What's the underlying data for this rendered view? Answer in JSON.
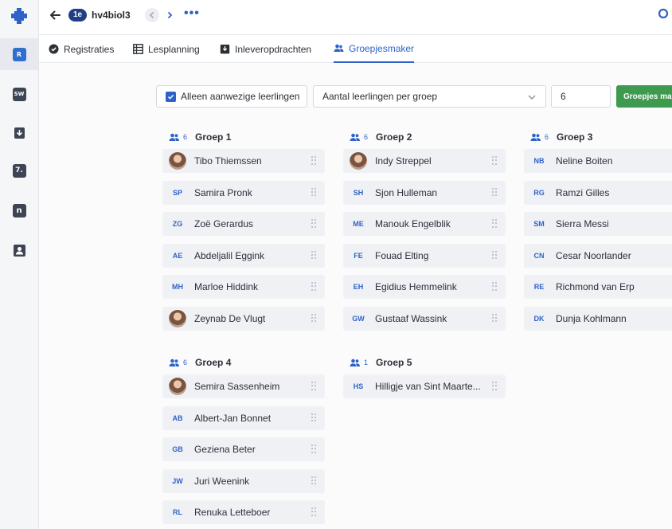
{
  "sidebar": {
    "items": [
      {
        "icon": "registration-icon",
        "label": "R",
        "active": true
      },
      {
        "icon": "sw-icon",
        "label": "SW",
        "active": false
      },
      {
        "icon": "assignment-icon",
        "label": "",
        "active": false
      },
      {
        "icon": "grade-icon",
        "label": "7.",
        "active": false
      },
      {
        "icon": "n-icon",
        "label": "n",
        "active": false
      },
      {
        "icon": "person-card-icon",
        "label": "",
        "active": false
      }
    ]
  },
  "header": {
    "badge": "1e",
    "title": "hv4biol3"
  },
  "tabs": [
    {
      "label": "Registraties",
      "icon": "check-circle-icon",
      "active": false
    },
    {
      "label": "Lesplanning",
      "icon": "table-icon",
      "active": false
    },
    {
      "label": "Inleveropdrachten",
      "icon": "inbox-icon",
      "active": false
    },
    {
      "label": "Groepjesmaker",
      "icon": "people-icon",
      "active": true
    }
  ],
  "controls": {
    "checkbox_label": "Alleen aanwezige leerlingen",
    "checkbox_checked": true,
    "select_value": "Aantal leerlingen per groep",
    "number_value": "6",
    "make_button": "Groepjes maken"
  },
  "groups": [
    {
      "count": "6",
      "name": "Groep 1",
      "members": [
        {
          "name": "Tibo Thiemssen",
          "initials": "",
          "photo": true
        },
        {
          "name": "Samira Pronk",
          "initials": "SP",
          "photo": false
        },
        {
          "name": "Zoë Gerardus",
          "initials": "ZG",
          "photo": false
        },
        {
          "name": "Abdeljalil Eggink",
          "initials": "AE",
          "photo": false
        },
        {
          "name": "Marloe Hiddink",
          "initials": "MH",
          "photo": false
        },
        {
          "name": "Zeynab De Vlugt",
          "initials": "",
          "photo": true
        }
      ]
    },
    {
      "count": "6",
      "name": "Groep 2",
      "members": [
        {
          "name": "Indy Streppel",
          "initials": "",
          "photo": true
        },
        {
          "name": "Sjon Hulleman",
          "initials": "SH",
          "photo": false
        },
        {
          "name": "Manouk Engelblik",
          "initials": "ME",
          "photo": false
        },
        {
          "name": "Fouad Elting",
          "initials": "FE",
          "photo": false
        },
        {
          "name": "Egidius Hemmelink",
          "initials": "EH",
          "photo": false
        },
        {
          "name": "Gustaaf Wassink",
          "initials": "GW",
          "photo": false
        }
      ]
    },
    {
      "count": "6",
      "name": "Groep 3",
      "members": [
        {
          "name": "Neline Boiten",
          "initials": "NB",
          "photo": false
        },
        {
          "name": "Ramzi Gilles",
          "initials": "RG",
          "photo": false
        },
        {
          "name": "Sierra Messi",
          "initials": "SM",
          "photo": false
        },
        {
          "name": "Cesar Noorlander",
          "initials": "CN",
          "photo": false
        },
        {
          "name": "Richmond van Erp",
          "initials": "RE",
          "photo": false
        },
        {
          "name": "Dunja Kohlmann",
          "initials": "DK",
          "photo": false
        }
      ]
    },
    {
      "count": "6",
      "name": "Groep 4",
      "members": [
        {
          "name": "Semira Sassenheim",
          "initials": "",
          "photo": true
        },
        {
          "name": "Albert-Jan Bonnet",
          "initials": "AB",
          "photo": false
        },
        {
          "name": "Geziena Beter",
          "initials": "GB",
          "photo": false
        },
        {
          "name": "Juri Weenink",
          "initials": "JW",
          "photo": false
        },
        {
          "name": "Renuka Letteboer",
          "initials": "RL",
          "photo": false
        }
      ]
    },
    {
      "count": "1",
      "name": "Groep 5",
      "members": [
        {
          "name": "Hilligje van Sint Maarte...",
          "initials": "HS",
          "photo": false
        }
      ]
    }
  ],
  "colors": {
    "accent": "#2f62c8",
    "success": "#3e9a4e",
    "badge": "#1f3f86"
  }
}
